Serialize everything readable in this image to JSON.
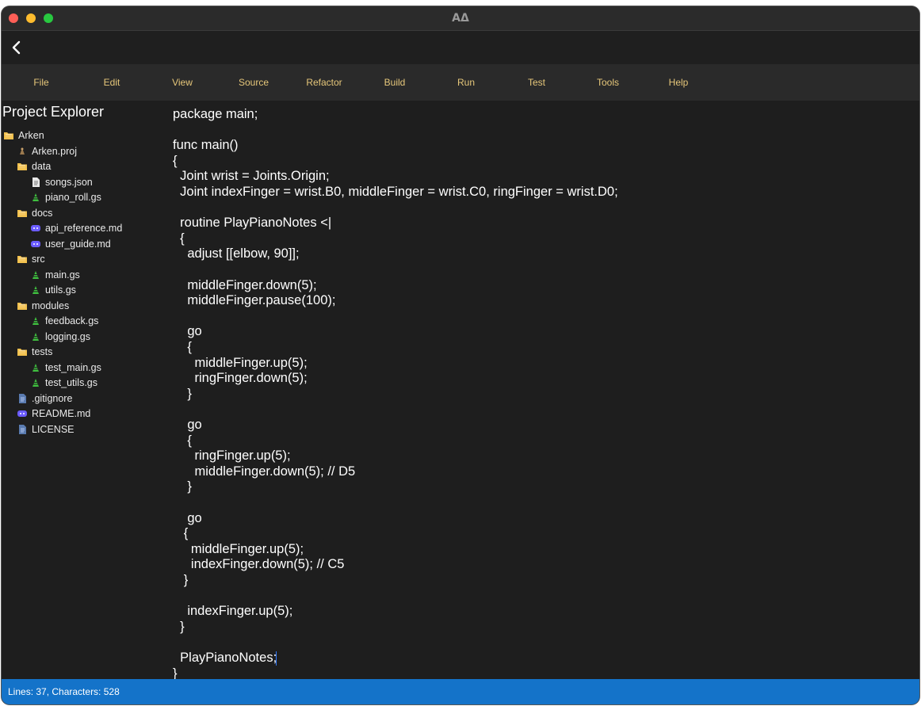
{
  "window": {
    "title": "AΔ"
  },
  "menu": [
    "File",
    "Edit",
    "View",
    "Source",
    "Refactor",
    "Build",
    "Run",
    "Test",
    "Tools",
    "Help"
  ],
  "sidebar": {
    "title": "Project Explorer",
    "items": [
      {
        "label": "Arken",
        "icon": "folder-icon",
        "level": 0
      },
      {
        "label": "Arken.proj",
        "icon": "project-file-icon",
        "level": 1
      },
      {
        "label": "data",
        "icon": "folder-icon",
        "level": 1
      },
      {
        "label": "songs.json",
        "icon": "json-file-icon",
        "level": 2
      },
      {
        "label": "piano_roll.gs",
        "icon": "gs-file-icon",
        "level": 2
      },
      {
        "label": "docs",
        "icon": "folder-icon",
        "level": 1
      },
      {
        "label": "api_reference.md",
        "icon": "markdown-file-icon",
        "level": 2
      },
      {
        "label": "user_guide.md",
        "icon": "markdown-file-icon",
        "level": 2
      },
      {
        "label": "src",
        "icon": "folder-icon",
        "level": 1
      },
      {
        "label": "main.gs",
        "icon": "gs-file-icon",
        "level": 2
      },
      {
        "label": "utils.gs",
        "icon": "gs-file-icon",
        "level": 2
      },
      {
        "label": "modules",
        "icon": "folder-icon",
        "level": 1
      },
      {
        "label": "feedback.gs",
        "icon": "gs-file-icon",
        "level": 2
      },
      {
        "label": "logging.gs",
        "icon": "gs-file-icon",
        "level": 2
      },
      {
        "label": "tests",
        "icon": "folder-icon",
        "level": 1
      },
      {
        "label": "test_main.gs",
        "icon": "gs-file-icon",
        "level": 2
      },
      {
        "label": "test_utils.gs",
        "icon": "gs-file-icon",
        "level": 2
      },
      {
        "label": ".gitignore",
        "icon": "text-file-icon",
        "level": 1
      },
      {
        "label": "README.md",
        "icon": "markdown-file-icon",
        "level": 1
      },
      {
        "label": "LICENSE",
        "icon": "text-file-icon",
        "level": 1
      }
    ]
  },
  "editor": {
    "lines": [
      "package main;",
      "",
      "func main()",
      "{",
      "  Joint wrist = Joints.Origin;",
      "  Joint indexFinger = wrist.B0, middleFinger = wrist.C0, ringFinger = wrist.D0;",
      "",
      "  routine PlayPianoNotes <|",
      "  {",
      "    adjust [[elbow, 90]];",
      "",
      "    middleFinger.down(5);",
      "    middleFinger.pause(100);",
      "",
      "    go",
      "    {",
      "      middleFinger.up(5);",
      "      ringFinger.down(5);",
      "    }",
      "",
      "    go",
      "    {",
      "      ringFinger.up(5);",
      "      middleFinger.down(5); // D5",
      "    }",
      "",
      "    go",
      "   {",
      "     middleFinger.up(5);",
      "     indexFinger.down(5); // C5",
      "   }",
      "",
      "    indexFinger.up(5);",
      "  }",
      "",
      "  PlayPianoNotes;",
      "}"
    ]
  },
  "status": {
    "text": "Lines: 37, Characters: 528"
  },
  "colors": {
    "menu_text": "#e6c77a",
    "status_bar": "#1473c9",
    "folder": "#f2c14e",
    "gs_file": "#3fbf3f",
    "markdown": "#6b5cff"
  }
}
